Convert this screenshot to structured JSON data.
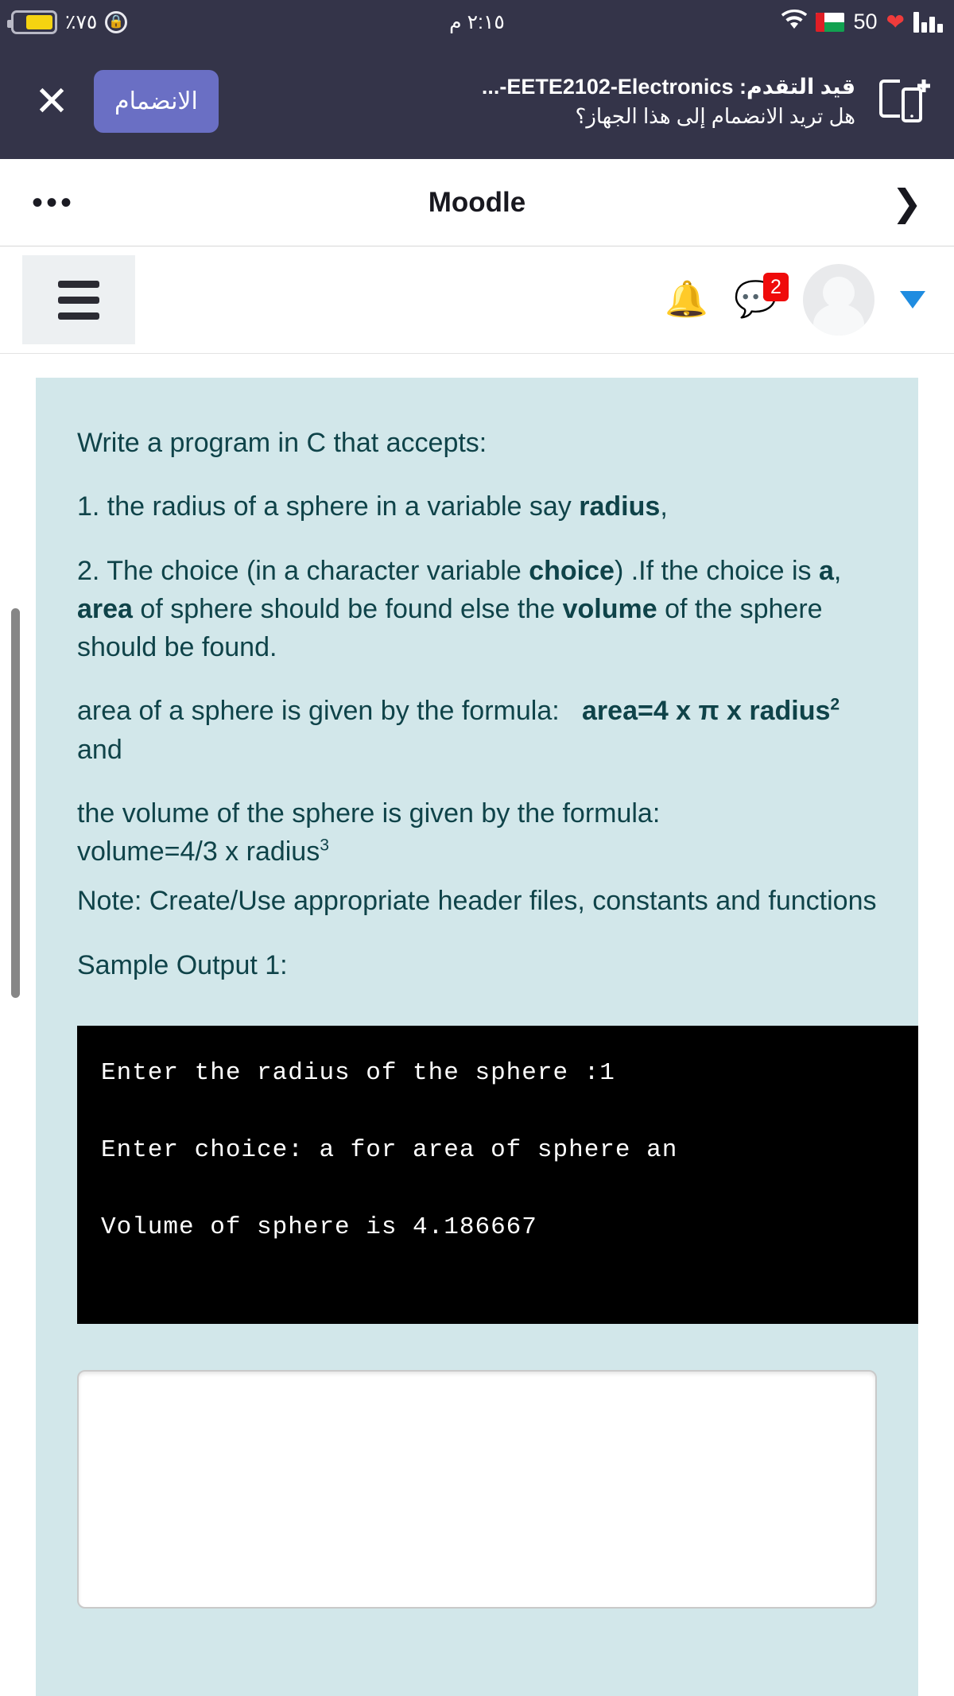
{
  "statusbar": {
    "battery_percent_label": "٪٧٥",
    "battery_level": 75,
    "battery_color": "#f5d311",
    "rotation_lock_icon": "rotation-lock-icon",
    "time": "٢:١٥ م",
    "wifi_icon": "wifi-icon",
    "flag_icon": "oman-flag-icon",
    "signal_number": "50",
    "heart_icon": "heart-icon",
    "signal_icon": "signal-bars-icon",
    "bar_color": "#343449"
  },
  "notification": {
    "close_label": "✕",
    "join_label": "الانضمام",
    "title": "قيد التقدم: EETE2102-Electronics-...",
    "subtitle": "هل تريد الانضمام إلى هذا الجهاز؟",
    "cast_icon": "cast-add-device-icon",
    "accent_color": "#6a6fc4"
  },
  "appbar": {
    "menu_icon": "overflow-dots-icon",
    "title": "Moodle",
    "forward_icon": "chevron-right-icon"
  },
  "moodlenav": {
    "hamburger_icon": "hamburger-menu-icon",
    "bell_icon": "notifications-bell-icon",
    "chat_icon": "messages-chat-icon",
    "chat_badge": "2",
    "badge_color": "#ef0b0b",
    "avatar_icon": "user-avatar",
    "caret_icon": "chevron-down-icon",
    "caret_color": "#1f8ce0"
  },
  "question": {
    "background_color": "#d2e7ea",
    "text_color": "#0f4349",
    "intro": "Write a program in C that accepts:",
    "item1_pre": "1. the radius of a sphere in a variable say ",
    "item1_bold": "radius",
    "item1_post": ",",
    "item2_a": "2. The choice (in a character variable ",
    "item2_b": "choice",
    "item2_c": ") .If the choice is ",
    "item2_d": "a",
    "item2_e": ", ",
    "item2_f": "area",
    "item2_g": " of sphere should be found else the ",
    "item2_h": "volume",
    "item2_i": " of the sphere should be found.",
    "area_pre": "area of a sphere is given by the formula:   ",
    "area_formula_a": "area=4 x π x radius",
    "area_formula_sup": "2",
    "area_post": "  and",
    "volume_line1": "the volume of the sphere is given by the formula:",
    "volume_formula": "volume=4/3 x radius",
    "volume_formula_sup": "3",
    "note": "Note: Create/Use appropriate header files, constants and functions",
    "sample_label": "Sample Output 1:"
  },
  "terminal": {
    "background_color": "#000000",
    "line1": "Enter the radius of the sphere :1",
    "line2": "Enter choice: a for area of sphere   an",
    "line3": "Volume of sphere is 4.186667"
  },
  "answer": {
    "value": "",
    "placeholder": ""
  },
  "scrollbar": {
    "color": "#868686"
  }
}
